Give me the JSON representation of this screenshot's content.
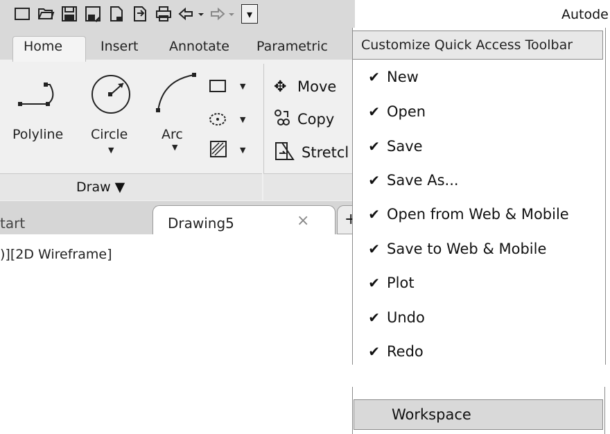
{
  "app": {
    "title": "Autode"
  },
  "qat": {
    "icons": [
      "new-icon",
      "open-icon",
      "save-icon",
      "save-as-icon",
      "open-from-web-icon",
      "save-to-web-icon",
      "plot-icon",
      "undo-icon",
      "redo-icon"
    ],
    "dropdown_glyph": "▾"
  },
  "ribbon": {
    "tabs": [
      "Home",
      "Insert",
      "Annotate",
      "Parametric"
    ],
    "draw": {
      "polyline_label": "Polyline",
      "circle_label": "Circle",
      "arc_label": "Arc",
      "panel_label": "Draw ▼"
    },
    "modify": {
      "move_label": "Move",
      "copy_label": "Copy",
      "stretch_label": "Stretcl"
    }
  },
  "doc_tabs": {
    "start_label": "tart",
    "drawing_label": "Drawing5",
    "close_glyph": "×",
    "plus_glyph": "+"
  },
  "viewport": {
    "label": ")][2D Wireframe]"
  },
  "menu": {
    "header": "Customize Quick Access Toolbar",
    "items": [
      {
        "label": "New",
        "checked": true
      },
      {
        "label": "Open",
        "checked": true
      },
      {
        "label": "Save",
        "checked": true
      },
      {
        "label": "Save As...",
        "checked": true
      },
      {
        "label": "Open from Web & Mobile",
        "checked": true
      },
      {
        "label": "Save to Web & Mobile",
        "checked": true
      },
      {
        "label": "Plot",
        "checked": true
      },
      {
        "label": "Undo",
        "checked": true
      },
      {
        "label": "Redo",
        "checked": true
      }
    ],
    "check_glyph": "✔",
    "workspace_label": "Workspace"
  }
}
